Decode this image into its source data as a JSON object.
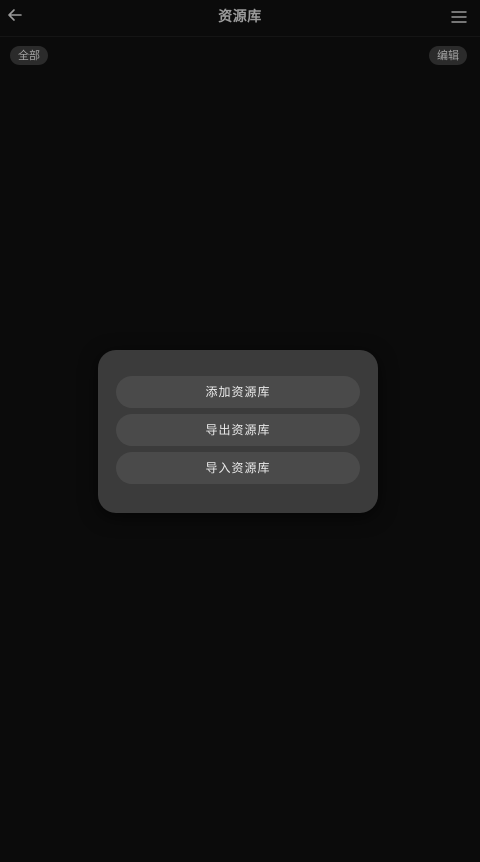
{
  "header": {
    "title": "资源库",
    "back_icon": "arrow-left-icon",
    "menu_icon": "hamburger-menu-icon"
  },
  "filters": {
    "all_label": "全部",
    "edit_label": "编辑"
  },
  "dialog": {
    "buttons": [
      {
        "label": "添加资源库"
      },
      {
        "label": "导出资源库"
      },
      {
        "label": "导入资源库"
      }
    ]
  },
  "colors": {
    "background": "#0b0b0b",
    "dialog_bg": "#3b3b3b",
    "button_bg": "#4a4a4a",
    "chip_bg": "#2b2b2b"
  }
}
